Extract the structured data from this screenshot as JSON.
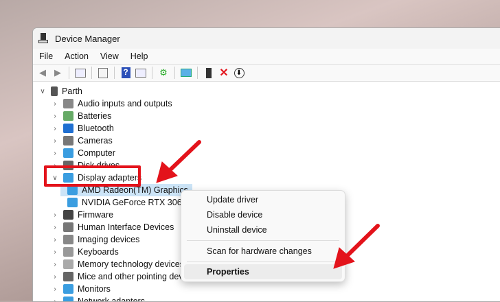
{
  "window": {
    "title": "Device Manager"
  },
  "menu": [
    "File",
    "Action",
    "View",
    "Help"
  ],
  "toolbar": [
    "back-icon",
    "forward-icon",
    "show-hide-tree-icon",
    "properties-icon",
    "help-icon",
    "action-pane-icon",
    "update-driver-icon",
    "scan-hardware-icon",
    "enable-device-icon",
    "uninstall-icon",
    "disable-icon"
  ],
  "tree": {
    "root": "Parth",
    "items": [
      "Audio inputs and outputs",
      "Batteries",
      "Bluetooth",
      "Cameras",
      "Computer",
      "Disk drives",
      "Display adapters",
      "AMD Radeon(TM) Graphics",
      "NVIDIA GeForce RTX 3060",
      "Firmware",
      "Human Interface Devices",
      "Imaging devices",
      "Keyboards",
      "Memory technology devices",
      "Mice and other pointing devices",
      "Monitors",
      "Network adapters"
    ]
  },
  "context_menu": {
    "items": [
      "Update driver",
      "Disable device",
      "Uninstall device",
      "Scan for hardware changes",
      "Properties"
    ]
  },
  "colors": {
    "accent": "#e3131b",
    "selection": "#cce4f7"
  }
}
